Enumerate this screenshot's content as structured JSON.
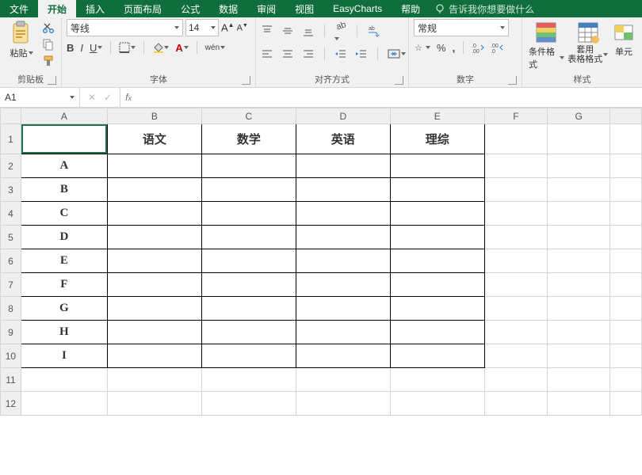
{
  "tabs": {
    "file": "文件",
    "home": "开始",
    "insert": "插入",
    "layout": "页面布局",
    "formula": "公式",
    "data": "数据",
    "review": "审阅",
    "view": "视图",
    "easy": "EasyCharts",
    "help": "帮助",
    "tellme": "告诉我你想要做什么"
  },
  "ribbon": {
    "clipboard": {
      "paste": "粘贴",
      "label": "剪贴板"
    },
    "font": {
      "name": "等线",
      "size": "14",
      "label": "字体",
      "bold": "B",
      "italic": "I",
      "underline": "U",
      "wen": "wén"
    },
    "align": {
      "label": "对齐方式"
    },
    "number": {
      "format": "常规",
      "label": "数字",
      "percent": "%"
    },
    "styles": {
      "cond": "条件格式",
      "table": "套用\n表格格式",
      "cell": "单元",
      "label": "样式"
    }
  },
  "nameBox": "A1",
  "columns": [
    "A",
    "B",
    "C",
    "D",
    "E",
    "F",
    "G",
    ""
  ],
  "headerRow": [
    "",
    "语文",
    "数学",
    "英语",
    "理综",
    "",
    "",
    ""
  ],
  "dataRows": [
    [
      "A",
      "",
      "",
      "",
      "",
      "",
      "",
      ""
    ],
    [
      "B",
      "",
      "",
      "",
      "",
      "",
      "",
      ""
    ],
    [
      "C",
      "",
      "",
      "",
      "",
      "",
      "",
      ""
    ],
    [
      "D",
      "",
      "",
      "",
      "",
      "",
      "",
      ""
    ],
    [
      "E",
      "",
      "",
      "",
      "",
      "",
      "",
      ""
    ],
    [
      "F",
      "",
      "",
      "",
      "",
      "",
      "",
      ""
    ],
    [
      "G",
      "",
      "",
      "",
      "",
      "",
      "",
      ""
    ],
    [
      "H",
      "",
      "",
      "",
      "",
      "",
      "",
      ""
    ],
    [
      "I",
      "",
      "",
      "",
      "",
      "",
      "",
      ""
    ],
    [
      "",
      "",
      "",
      "",
      "",
      "",
      "",
      ""
    ],
    [
      "",
      "",
      "",
      "",
      "",
      "",
      "",
      ""
    ]
  ]
}
